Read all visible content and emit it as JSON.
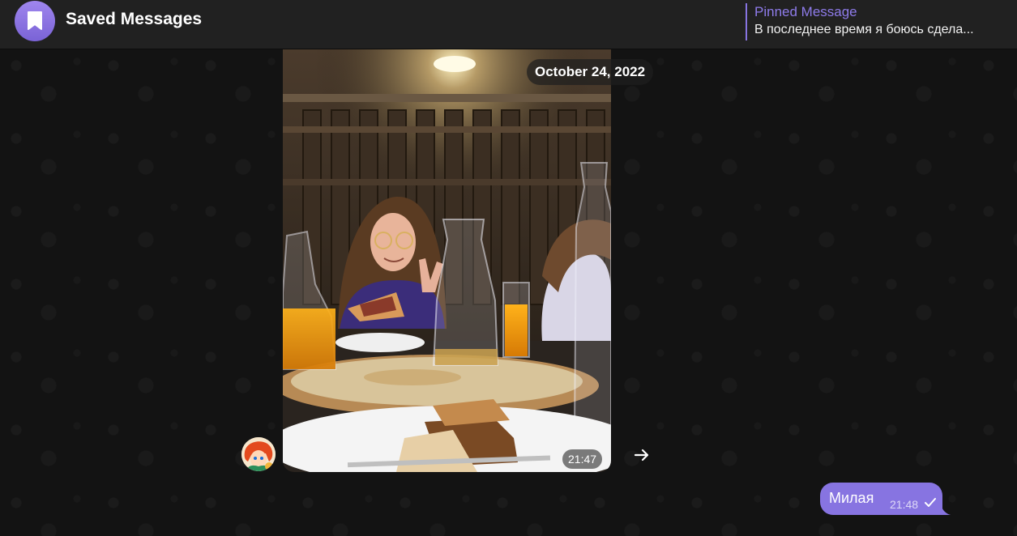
{
  "header": {
    "title": "Saved Messages",
    "avatar_icon": "bookmark-icon",
    "pinned": {
      "title": "Pinned Message",
      "text": "В последнее время я боюсь сдела..."
    }
  },
  "message_photo": {
    "date_chip": "October 24, 2022",
    "time": "21:47",
    "forward_icon": "arrow-right-icon",
    "sender_avatar_icon": "cartoon-avatar"
  },
  "message_text": {
    "text": "Милая",
    "time": "21:48",
    "status_icon": "single-check-icon"
  },
  "colors": {
    "accent": "#8774e1",
    "header_bg": "#212121",
    "chat_bg": "#131313"
  }
}
